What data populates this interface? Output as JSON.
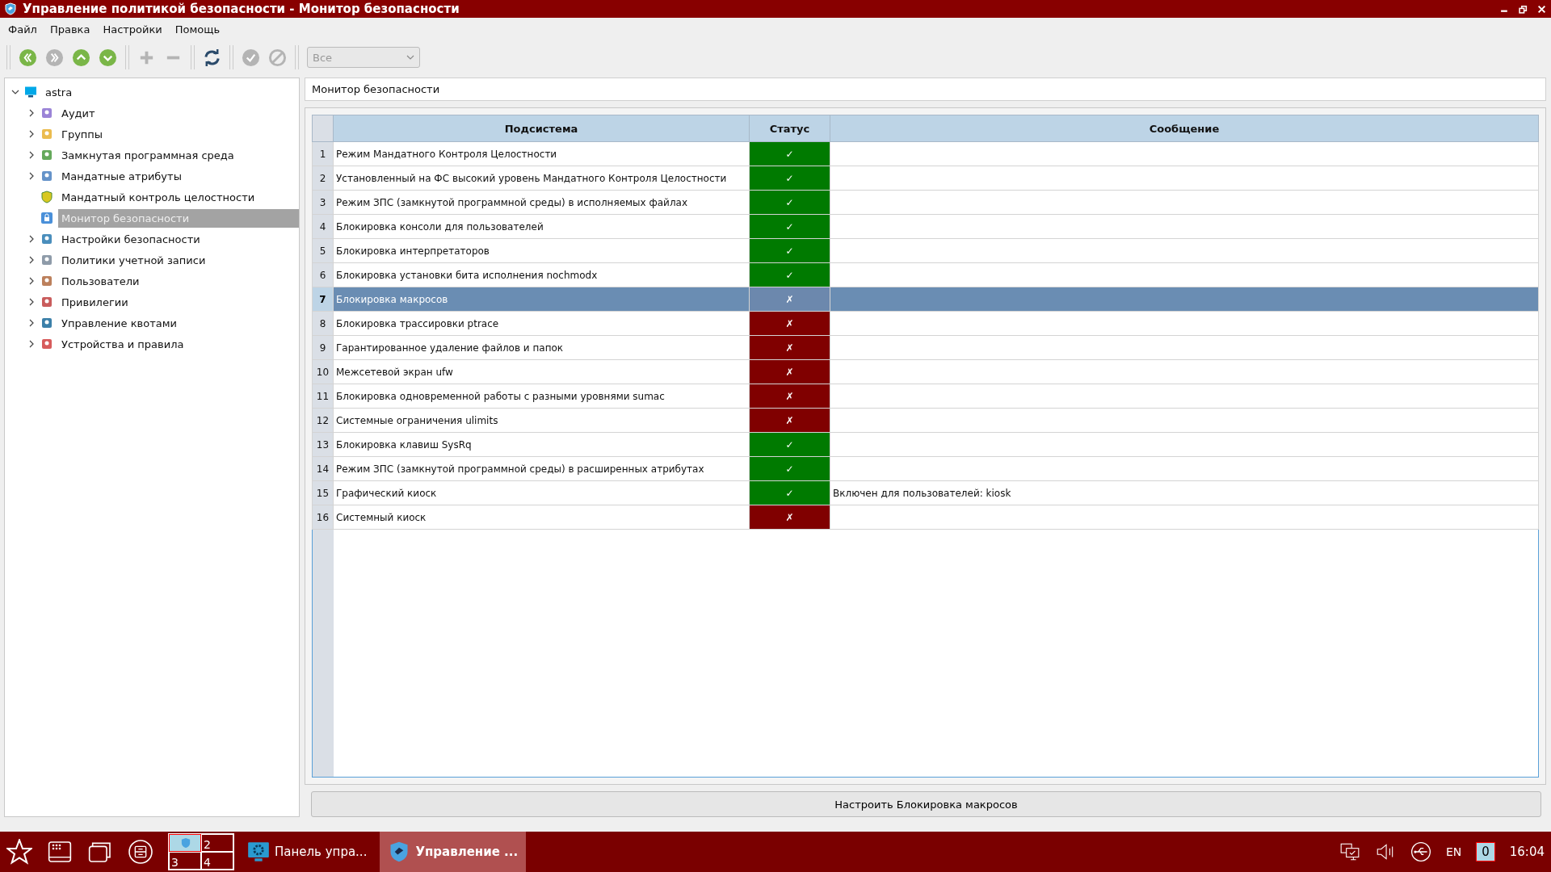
{
  "window": {
    "title": "Управление политикой безопасности - Монитор безопасности"
  },
  "menu": [
    "Файл",
    "Правка",
    "Настройки",
    "Помощь"
  ],
  "toolbar": [
    {
      "kind": "back",
      "disabled": false
    },
    {
      "kind": "forward",
      "disabled": true
    },
    {
      "kind": "up",
      "disabled": false
    },
    {
      "kind": "down",
      "disabled": false
    },
    {
      "kind": "add",
      "disabled": true
    },
    {
      "kind": "remove",
      "disabled": true
    },
    {
      "kind": "refresh",
      "disabled": false
    },
    {
      "kind": "apply",
      "disabled": true
    },
    {
      "kind": "cancel",
      "disabled": true
    }
  ],
  "filter": {
    "value": "Все",
    "disabled": true
  },
  "tree": {
    "label": "astra",
    "expanded": true,
    "children": [
      {
        "label": "Аудит",
        "kind": "audit",
        "expandable": true,
        "selected": false
      },
      {
        "label": "Группы",
        "kind": "group",
        "expandable": true,
        "selected": false
      },
      {
        "label": "Замкнутая программная среда",
        "kind": "env",
        "expandable": true,
        "selected": false
      },
      {
        "label": "Мандатные атрибуты",
        "kind": "attr",
        "expandable": true,
        "selected": false
      },
      {
        "label": "Мандатный контроль целостности",
        "kind": "shield",
        "expandable": false,
        "selected": false
      },
      {
        "label": "Монитор безопасности",
        "kind": "lock",
        "expandable": false,
        "selected": true
      },
      {
        "label": "Настройки безопасности",
        "kind": "tools",
        "expandable": true,
        "selected": false
      },
      {
        "label": "Политики учетной записи",
        "kind": "account",
        "expandable": true,
        "selected": false
      },
      {
        "label": "Пользователи",
        "kind": "users",
        "expandable": true,
        "selected": false
      },
      {
        "label": "Привилегии",
        "kind": "priv",
        "expandable": true,
        "selected": false
      },
      {
        "label": "Управление квотами",
        "kind": "quota",
        "expandable": true,
        "selected": false
      },
      {
        "label": "Устройства и правила",
        "kind": "device",
        "expandable": true,
        "selected": false
      }
    ]
  },
  "panel_title": "Монитор безопасности",
  "table": {
    "columns": [
      "Подсистема",
      "Статус",
      "Сообщение"
    ],
    "rows": [
      {
        "n": "1",
        "subsystem": "Режим Мандатного Контроля Целостности",
        "passed": true,
        "mark": "✓",
        "selected": false
      },
      {
        "n": "2",
        "subsystem": "Установленный на ФС высокий уровень Мандатного Контроля Целостности",
        "passed": true,
        "mark": "✓",
        "selected": false
      },
      {
        "n": "3",
        "subsystem": "Режим ЗПС (замкнутой программной среды) в исполняемых файлах",
        "passed": true,
        "mark": "✓",
        "selected": false
      },
      {
        "n": "4",
        "subsystem": "Блокировка консоли для пользователей",
        "passed": true,
        "mark": "✓",
        "selected": false
      },
      {
        "n": "5",
        "subsystem": "Блокировка интерпретаторов",
        "passed": true,
        "mark": "✓",
        "selected": false
      },
      {
        "n": "6",
        "subsystem": "Блокировка установки бита исполнения nochmodx",
        "passed": true,
        "mark": "✓",
        "selected": false
      },
      {
        "n": "7",
        "subsystem": "Блокировка макросов",
        "passed": false,
        "mark": "✗",
        "selected": true
      },
      {
        "n": "8",
        "subsystem": "Блокировка трассировки ptrace",
        "passed": false,
        "mark": "✗",
        "selected": false
      },
      {
        "n": "9",
        "subsystem": "Гарантированное удаление файлов и папок",
        "passed": false,
        "mark": "✗",
        "selected": false
      },
      {
        "n": "10",
        "subsystem": "Межсетевой экран ufw",
        "passed": false,
        "mark": "✗",
        "selected": false
      },
      {
        "n": "11",
        "subsystem": "Блокировка одновременной работы с разными уровнями sumac",
        "passed": false,
        "mark": "✗",
        "selected": false
      },
      {
        "n": "12",
        "subsystem": "Системные ограничения ulimits",
        "passed": false,
        "mark": "✗",
        "selected": false
      },
      {
        "n": "13",
        "subsystem": "Блокировка клавиш SysRq",
        "passed": true,
        "mark": "✓",
        "selected": false
      },
      {
        "n": "14",
        "subsystem": "Режим ЗПС (замкнутой программной среды) в расширенных атрибутах",
        "passed": true,
        "mark": "✓",
        "selected": false
      },
      {
        "n": "15",
        "subsystem": "Графический киоск",
        "passed": true,
        "mark": "✓",
        "message": "Включен для пользователей: kiosk",
        "selected": false
      },
      {
        "n": "16",
        "subsystem": "Системный киоск",
        "passed": false,
        "mark": "✗",
        "selected": false
      }
    ]
  },
  "configure_button": "Настроить Блокировка макросов",
  "taskbar": {
    "desktops": [
      {
        "selected": true
      },
      {
        "label": "2",
        "selected": false
      },
      {
        "label": "3",
        "selected": false
      },
      {
        "label": "4",
        "selected": false
      }
    ],
    "tasks": [
      {
        "label": "Панель упра...",
        "kind": "panel",
        "selected": false
      },
      {
        "label": "Управление ...",
        "kind": "security",
        "selected": true
      }
    ],
    "language": "EN",
    "notifications": "0",
    "clock": "16:04"
  }
}
